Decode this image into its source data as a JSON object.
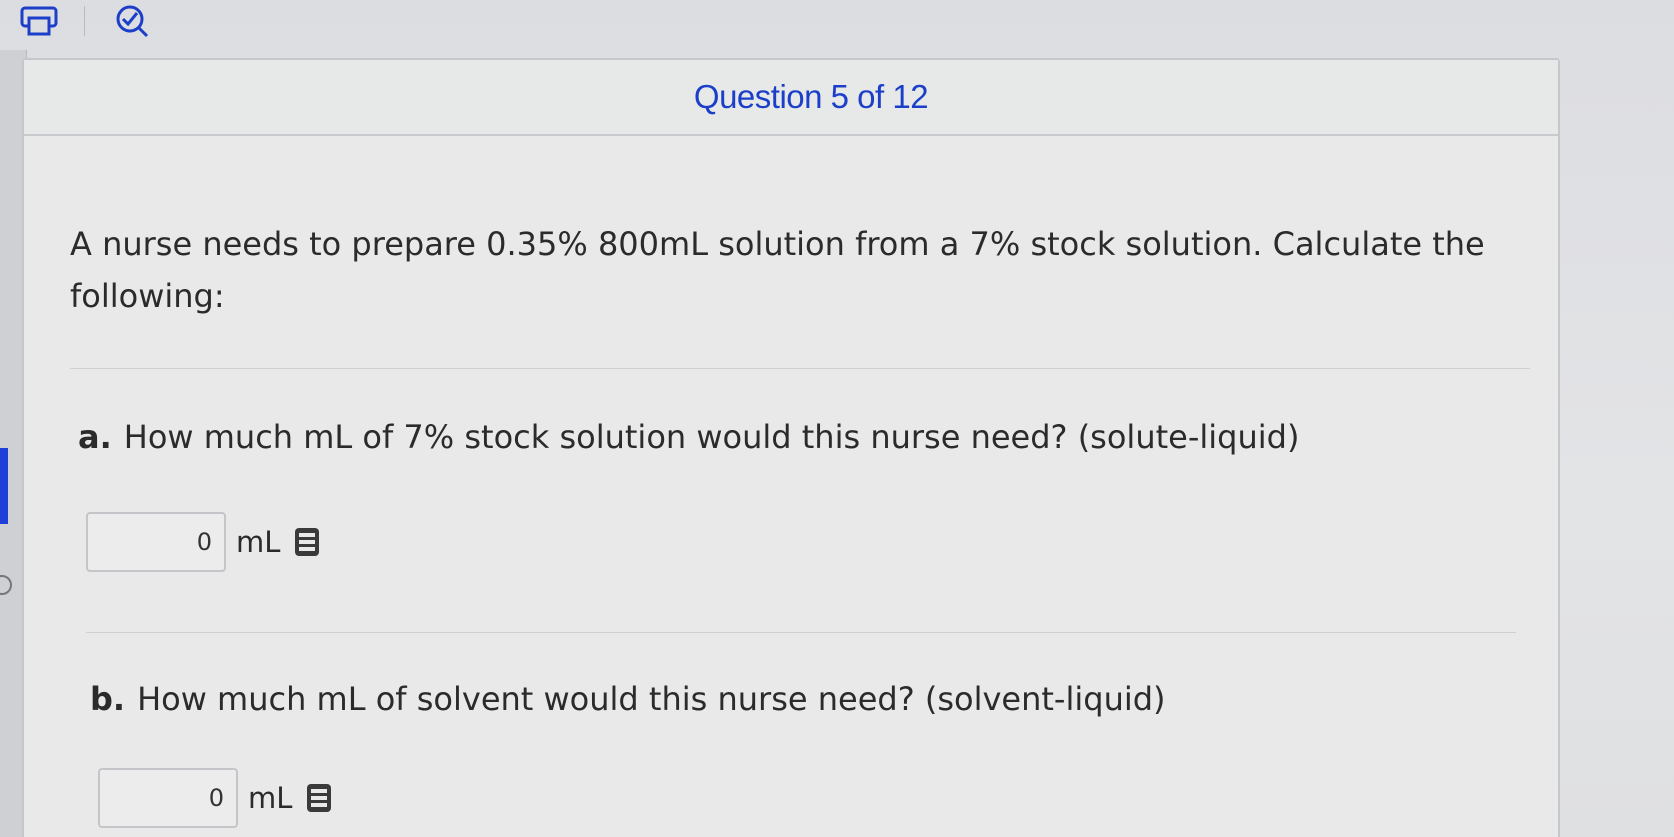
{
  "toolbar": {
    "icons": [
      "print-icon",
      "checklist-icon"
    ]
  },
  "header": {
    "question_counter": "Question 5 of 12"
  },
  "question": {
    "prompt": "A nurse needs to prepare 0.35% 800mL solution from a 7% stock solution. Calculate the following:"
  },
  "parts": [
    {
      "letter": "a.",
      "text": "How much mL of 7% stock solution would this nurse need? (solute-liquid)",
      "answer_value": "0",
      "unit": "mL",
      "icon": "calculator-icon"
    },
    {
      "letter": "b.",
      "text": "How much mL of solvent would this nurse need? (solvent-liquid)",
      "answer_value": "0",
      "unit": "mL",
      "icon": "calculator-icon"
    }
  ],
  "colors": {
    "accent": "#1c3fc9",
    "text": "#2b2b2b",
    "card_bg": "#e9e9e9"
  }
}
